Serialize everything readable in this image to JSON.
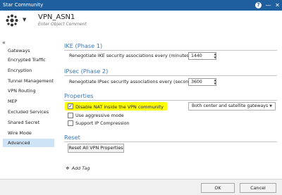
{
  "window": {
    "title": "Star Community",
    "help_icon": "help-icon",
    "minimize_icon": "minimize-icon",
    "close_icon": "close-icon"
  },
  "object": {
    "icon": "community-icon",
    "name": "VPN_ASN1",
    "comment_placeholder": "Enter Object Comment"
  },
  "sidebar": {
    "collapse": "«",
    "items": [
      {
        "label": "Gateways",
        "active": false
      },
      {
        "label": "Encrypted Traffic",
        "active": false
      },
      {
        "label": "Encryption",
        "active": false
      },
      {
        "label": "Tunnel Management",
        "active": false
      },
      {
        "label": "VPN Routing",
        "active": false
      },
      {
        "label": "MEP",
        "active": false
      },
      {
        "label": "Excluded Services",
        "active": false
      },
      {
        "label": "Shared Secret",
        "active": false
      },
      {
        "label": "Wire Mode",
        "active": false
      },
      {
        "label": "Advanced",
        "active": true
      }
    ]
  },
  "ike": {
    "title": "IKE (Phase 1)",
    "label": "Renegotiate IKE security associations every (minutes):",
    "value": "1440"
  },
  "ipsec": {
    "title": "IPsec (Phase 2)",
    "label": "Renegotiate IPsec security associations every (seconds):",
    "value": "3600"
  },
  "properties": {
    "title": "Properties",
    "options": [
      {
        "label": "Disable NAT inside the VPN community",
        "checked": true,
        "highlighted": true
      },
      {
        "label": "Use aggressive mode",
        "checked": false
      },
      {
        "label": "Support IP Compression",
        "checked": false
      }
    ],
    "nat_scope": "Both center and satellite gateways"
  },
  "reset": {
    "title": "Reset",
    "button": "Reset All VPN Properties"
  },
  "tag": {
    "label": "Add Tag"
  },
  "footer": {
    "ok": "OK",
    "cancel": "Cancel"
  },
  "colors": {
    "titlebar": "#1f5f9d",
    "section_title": "#3a78b5",
    "highlight": "#ffff00",
    "active_item": "#cfe3f7"
  }
}
